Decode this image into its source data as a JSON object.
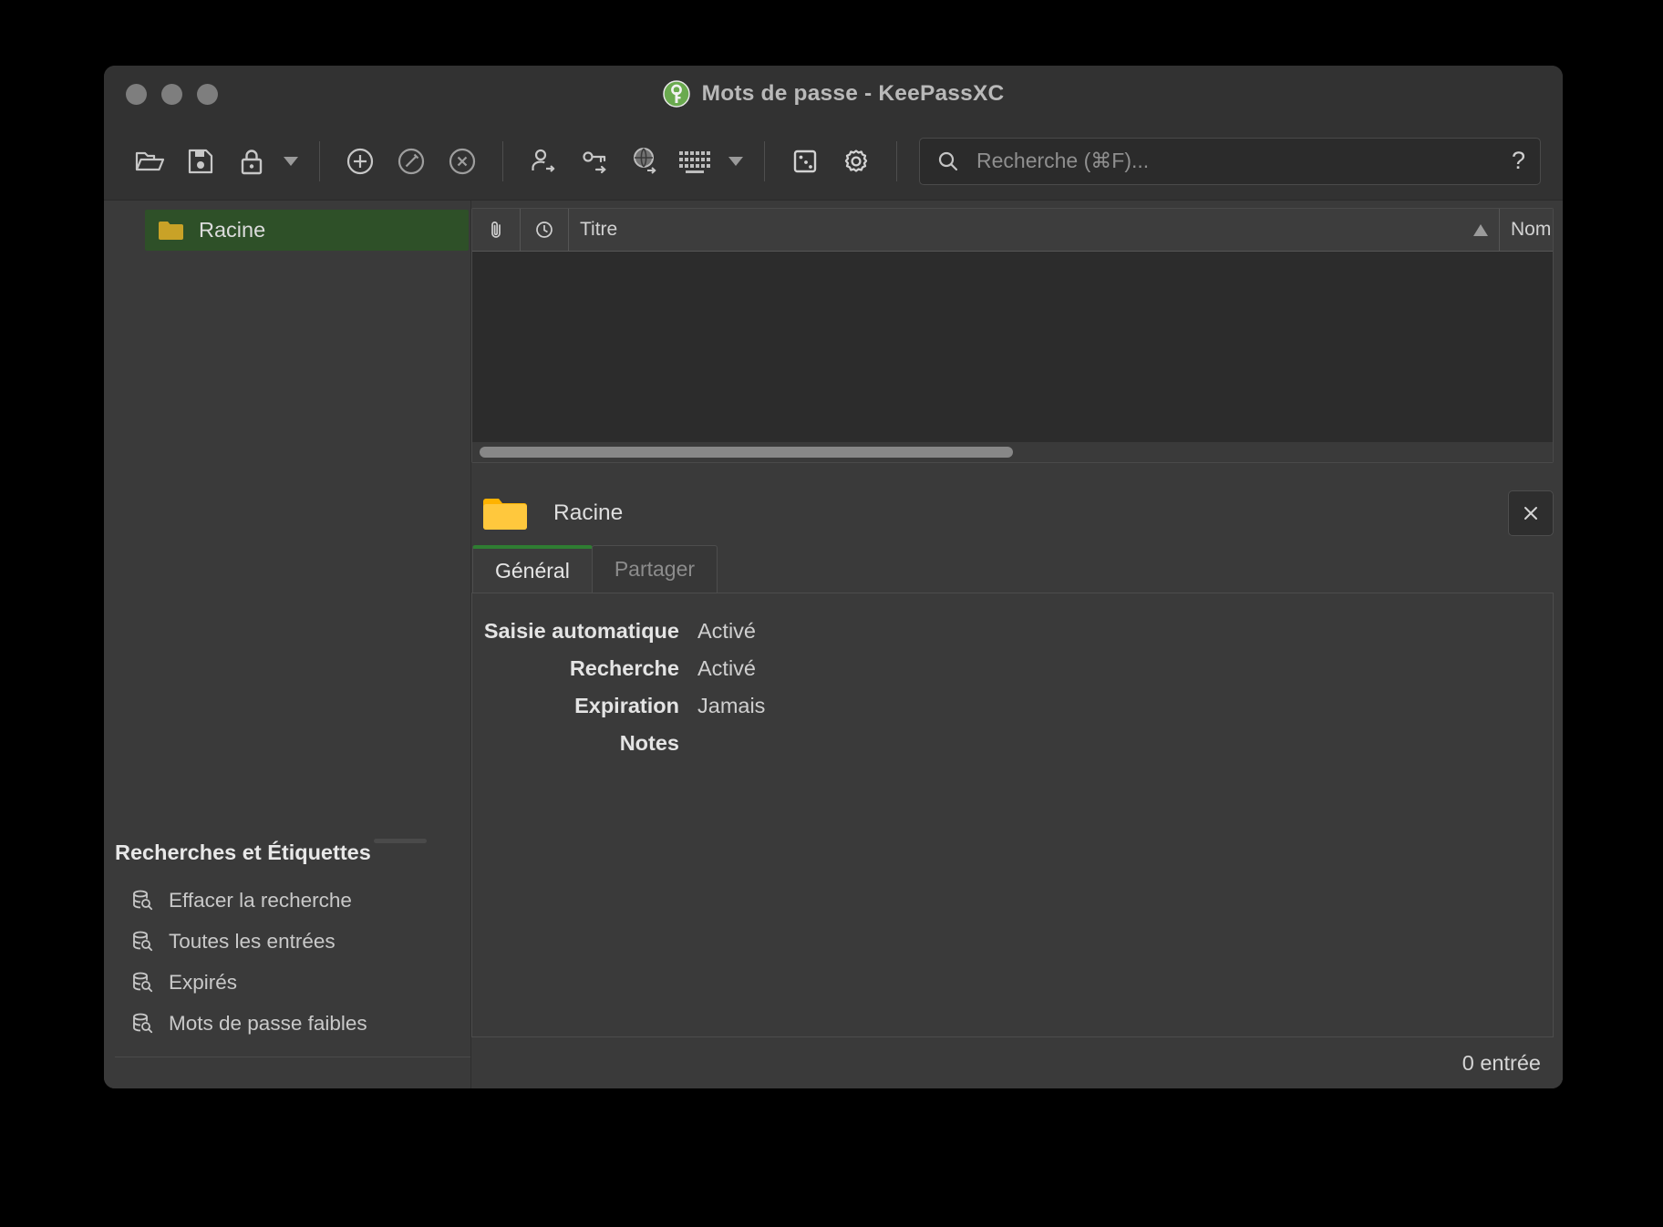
{
  "window": {
    "title": "Mots de passe - KeePassXC",
    "app_icon": "keepassxc-logo-icon",
    "traffic_lights": [
      "close-button",
      "minimize-button",
      "maximize-button"
    ]
  },
  "toolbar": {
    "buttons": [
      {
        "name": "open-database-button",
        "icon": "folder-open-icon"
      },
      {
        "name": "save-database-button",
        "icon": "floppy-save-icon"
      },
      {
        "name": "lock-database-button",
        "icon": "lock-icon"
      },
      {
        "name": "lock-database-dropdown",
        "icon": "chevron-down-icon"
      },
      {
        "name": "new-entry-button",
        "icon": "plus-circle-icon"
      },
      {
        "name": "edit-entry-button",
        "icon": "pencil-circle-icon"
      },
      {
        "name": "delete-entry-button",
        "icon": "x-circle-icon"
      },
      {
        "name": "copy-username-button",
        "icon": "user-arrow-icon"
      },
      {
        "name": "copy-password-button",
        "icon": "key-arrow-icon"
      },
      {
        "name": "open-url-button",
        "icon": "globe-arrow-icon"
      },
      {
        "name": "auto-type-button",
        "icon": "keyboard-icon"
      },
      {
        "name": "auto-type-dropdown",
        "icon": "chevron-down-icon"
      },
      {
        "name": "password-generator-button",
        "icon": "dice-icon"
      },
      {
        "name": "settings-button",
        "icon": "gear-icon"
      }
    ]
  },
  "search": {
    "placeholder": "Recherche (⌘F)...",
    "value": "",
    "icon": "search-icon",
    "help_label": "?"
  },
  "sidebar": {
    "groups": [
      {
        "label": "Racine",
        "icon": "folder-icon",
        "selected": true
      }
    ],
    "searches_title": "Recherches et Étiquettes",
    "searches": [
      {
        "label": "Effacer la recherche",
        "icon": "database-search-icon"
      },
      {
        "label": "Toutes les entrées",
        "icon": "database-search-icon"
      },
      {
        "label": "Expirés",
        "icon": "database-search-icon"
      },
      {
        "label": "Mots de passe faibles",
        "icon": "database-search-icon"
      }
    ]
  },
  "entry_table": {
    "columns": [
      {
        "label": "",
        "icon": "paperclip-icon",
        "name": "attachment-column"
      },
      {
        "label": "",
        "icon": "clock-icon",
        "name": "expiry-column"
      },
      {
        "label": "Titre",
        "name": "title-column",
        "sorted": "asc",
        "sort_icon": "sort-ascending-arrow"
      },
      {
        "label": "Nom",
        "name": "username-column"
      }
    ],
    "rows": []
  },
  "detail": {
    "folder_icon": "folder-icon",
    "title": "Racine",
    "close_label": "×",
    "tabs": [
      {
        "label": "Général",
        "active": true
      },
      {
        "label": "Partager",
        "active": false
      }
    ],
    "fields": [
      {
        "label": "Saisie automatique",
        "value": "Activé"
      },
      {
        "label": "Recherche",
        "value": "Activé"
      },
      {
        "label": "Expiration",
        "value": "Jamais"
      },
      {
        "label": "Notes",
        "value": ""
      }
    ]
  },
  "statusbar": {
    "entry_count": "0 entrée"
  },
  "colors": {
    "selection_green": "#2e5028",
    "tab_accent_green": "#2f7d32",
    "folder_yellow": "#ffc430",
    "window_bg": "#353535"
  }
}
